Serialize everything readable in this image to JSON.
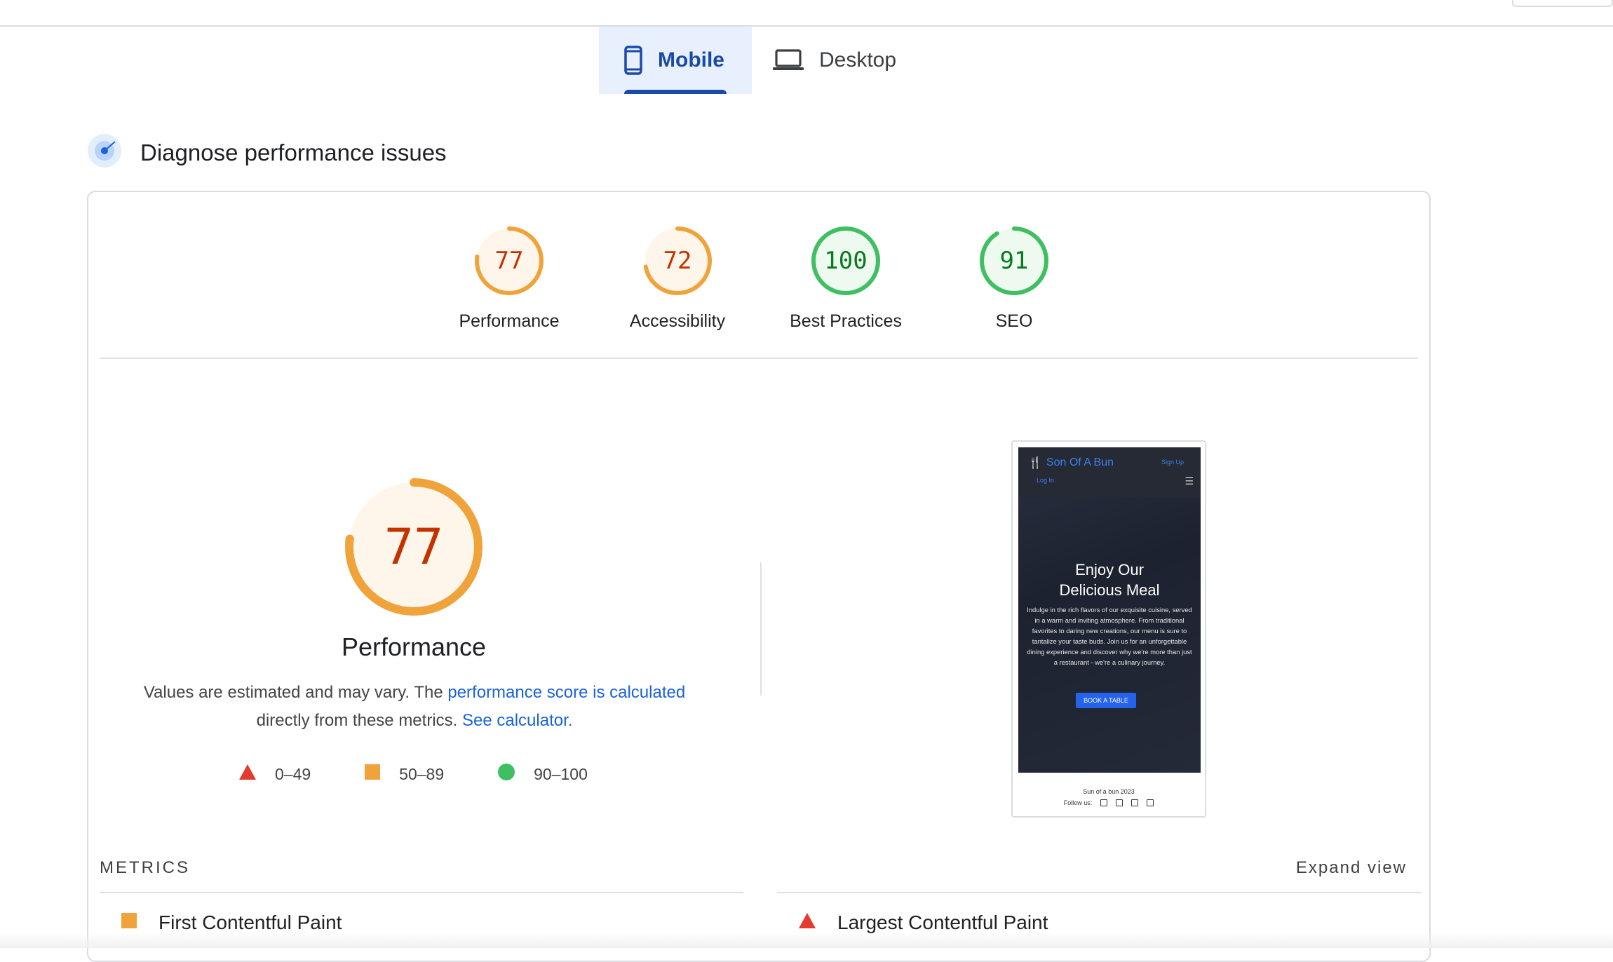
{
  "tabs": [
    {
      "label": "Mobile",
      "icon": "phone-icon",
      "active": true
    },
    {
      "label": "Desktop",
      "icon": "laptop-icon",
      "active": false
    }
  ],
  "section": {
    "title": "Diagnose performance issues",
    "icon": "target-icon"
  },
  "scores": [
    {
      "value": 77,
      "label": "Performance",
      "status": "average"
    },
    {
      "value": 72,
      "label": "Accessibility",
      "status": "average"
    },
    {
      "value": 100,
      "label": "Best Practices",
      "status": "pass"
    },
    {
      "value": 91,
      "label": "SEO",
      "status": "pass"
    }
  ],
  "performance": {
    "score": 77,
    "title": "Performance",
    "desc_prefix": "Values are estimated and may vary. The ",
    "desc_link": "performance score is calculated",
    "desc_middle": " directly from these metrics. ",
    "calc_link": "See calculator."
  },
  "legend": [
    {
      "range": "0–49",
      "shape": "triangle",
      "color": "#e33b2e"
    },
    {
      "range": "50–89",
      "shape": "square",
      "color": "#f0a33a"
    },
    {
      "range": "90–100",
      "shape": "circle",
      "color": "#3fbf62"
    }
  ],
  "screenshot": {
    "brand": "Son Of A Bun",
    "signup": "Sign Up",
    "login": "Log In",
    "headline_1": "Enjoy Our",
    "headline_2": "Delicious Meal",
    "paragraph": "Indulge in the rich flavors of our exquisite cuisine, served in a warm and inviting atmosphere. From traditional favorites to daring new creations, our menu is sure to tantalize your taste buds. Join us for an unforgettable dining experience and discover why we're more than just a restaurant - we're a culinary journey.",
    "button": "BOOK A TABLE",
    "footer": "Sun of a bun 2023",
    "follow": "Follow us:"
  },
  "metrics": {
    "heading": "METRICS",
    "expand": "Expand view",
    "items": [
      {
        "label": "First Contentful Paint",
        "status": "average"
      },
      {
        "label": "Largest Contentful Paint",
        "status": "fail"
      }
    ]
  },
  "colors": {
    "average_ring": "#f0a33a",
    "average_fill": "#fef6ea",
    "average_text": "#c33300",
    "pass_ring": "#3fbf62",
    "pass_fill": "#eefaf0",
    "pass_text": "#0a7a1f",
    "active_tab": "#1a4aa8",
    "link": "#1a62d8"
  }
}
